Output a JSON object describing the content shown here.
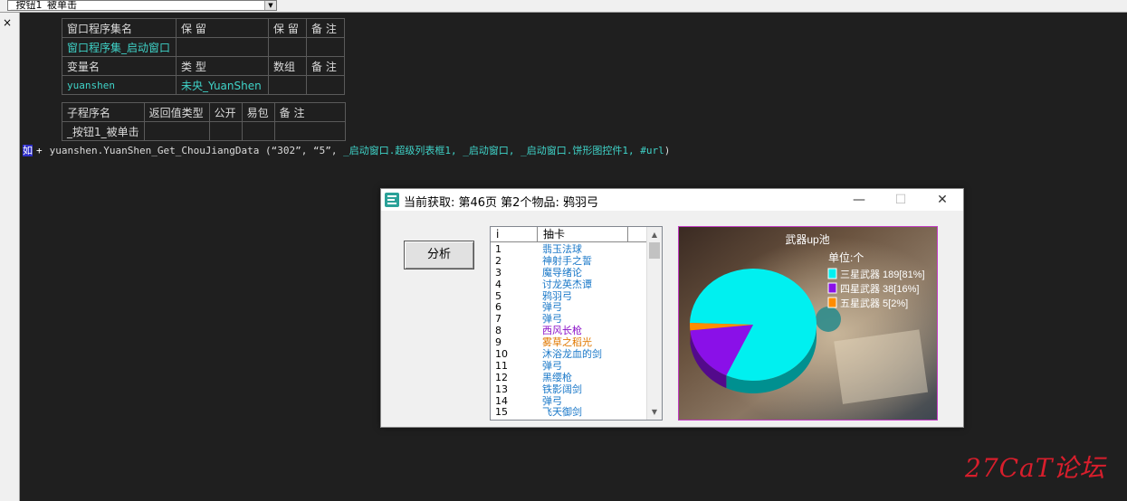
{
  "topbar": {
    "combo_value": "_按钮1_被单击"
  },
  "gutter": {
    "close_glyph": "×"
  },
  "program_set": {
    "header": [
      "窗口程序集名",
      "保 留",
      "保 留",
      "备 注"
    ],
    "row": [
      "窗口程序集_启动窗口",
      "",
      "",
      ""
    ]
  },
  "variables": {
    "header": [
      "变量名",
      "类 型",
      "数组",
      "备 注"
    ],
    "row": [
      "yuanshen",
      "未央_YuanShen",
      "",
      ""
    ]
  },
  "subroutine": {
    "header": [
      "子程序名",
      "返回值类型",
      "公开",
      "易包",
      "备 注"
    ],
    "row": [
      "_按钮1_被单击",
      "",
      "",
      "",
      ""
    ]
  },
  "code": {
    "marker": "如",
    "plus": "+",
    "prefix": "yuanshen.YuanShen_Get_ChouJiangData (",
    "args_literal": "“302”, “5”, ",
    "args_ref": "_启动窗口.超级列表框1, _启动窗口, _启动窗口.饼形图控件1, #url",
    "suffix": ")"
  },
  "window": {
    "title": "当前获取:  第46页 第2个物品:  鸦羽弓",
    "minimize": "—",
    "maximize": "☐",
    "close": "✕",
    "analyze_label": "分析"
  },
  "list": {
    "col_index": "i",
    "col_name": "抽卡",
    "scroll_up": "▲",
    "scroll_down": "▼",
    "rows": [
      {
        "n": "1",
        "name": "翡玉法球",
        "color": "#1a78c8"
      },
      {
        "n": "2",
        "name": "神射手之誓",
        "color": "#1a78c8"
      },
      {
        "n": "3",
        "name": "魔导绪论",
        "color": "#1a78c8"
      },
      {
        "n": "4",
        "name": "讨龙英杰谭",
        "color": "#1a78c8"
      },
      {
        "n": "5",
        "name": "鸦羽弓",
        "color": "#1a78c8"
      },
      {
        "n": "6",
        "name": "弹弓",
        "color": "#1a78c8"
      },
      {
        "n": "7",
        "name": "弹弓",
        "color": "#1a78c8"
      },
      {
        "n": "8",
        "name": "西风长枪",
        "color": "#8a10c8"
      },
      {
        "n": "9",
        "name": "雾草之稻光",
        "color": "#e07800"
      },
      {
        "n": "10",
        "name": "沐浴龙血的剑",
        "color": "#1a78c8"
      },
      {
        "n": "11",
        "name": "弹弓",
        "color": "#1a78c8"
      },
      {
        "n": "12",
        "name": "黑缨枪",
        "color": "#1a78c8"
      },
      {
        "n": "13",
        "name": "铁影阔剑",
        "color": "#1a78c8"
      },
      {
        "n": "14",
        "name": "弹弓",
        "color": "#1a78c8"
      },
      {
        "n": "15",
        "name": "飞天御剑",
        "color": "#1a78c8"
      }
    ]
  },
  "chart_data": {
    "type": "pie",
    "title": "武器up池",
    "unit_label": "单位:个",
    "legend_position": "right",
    "slices": [
      {
        "label": "三星武器 189[81%]",
        "value": 189,
        "color": "#00f0f0"
      },
      {
        "label": "四星武器 38[16%]",
        "value": 38,
        "color": "#8a10e8"
      },
      {
        "label": "五星武器 5[2%]",
        "value": 5,
        "color": "#ff8c00"
      }
    ]
  },
  "watermark": "27CaT论坛"
}
